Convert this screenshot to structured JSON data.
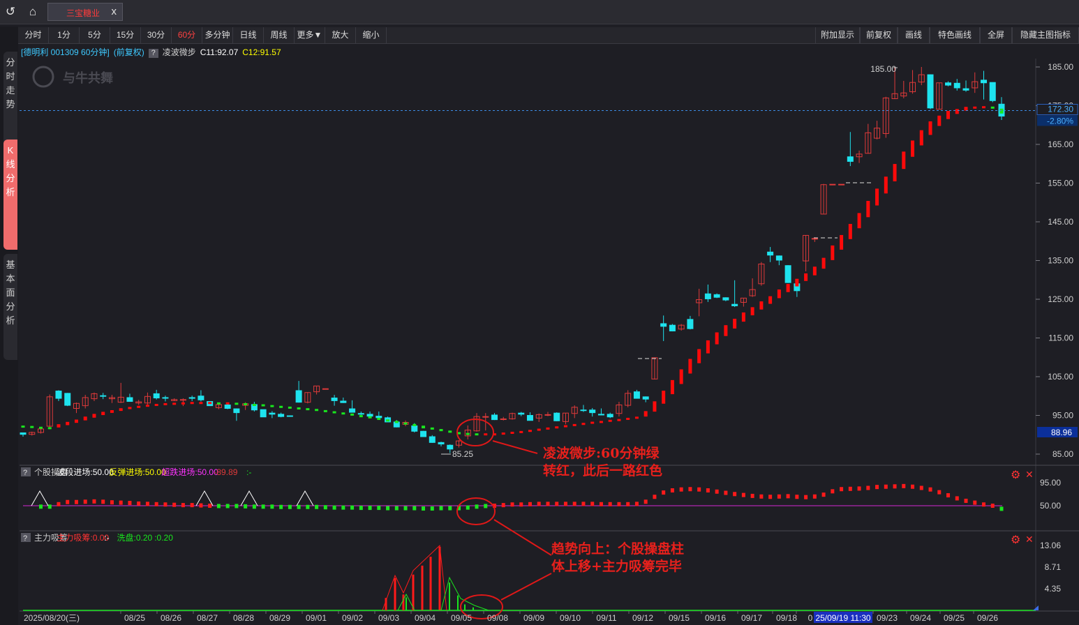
{
  "topbar": {
    "back_icon": "undo-arrow-icon",
    "home_icon": "home-icon",
    "doc_tab": "三宝糖业",
    "close": "x"
  },
  "sidebar": {
    "tabs": [
      {
        "label": "分时走势"
      },
      {
        "label": "K线分析"
      },
      {
        "label": "基本面分析"
      }
    ]
  },
  "toolbar": {
    "left": [
      "分时",
      "1分",
      "5分",
      "15分",
      "30分",
      "60分",
      "多分钟",
      "日线",
      "周线",
      "更多▼",
      "放大",
      "缩小"
    ],
    "right": [
      "附加显示",
      "前复权",
      "画线",
      "特色画线",
      "全屏",
      "隐藏主图指标"
    ],
    "active": "60分"
  },
  "info": {
    "stock": "[德明利 001309 60分钟]",
    "adj": "(前复权)",
    "help": "?",
    "indicator": "凌波微步",
    "c11": "C11:92.07",
    "c12": "C12:91.57"
  },
  "watermark": "与牛共舞",
  "main_chart": {
    "y_ticks": [
      "185.00",
      "175.00",
      "165.00",
      "155.00",
      "145.00",
      "135.00",
      "125.00",
      "115.00",
      "105.00",
      "95.00",
      "85.00"
    ],
    "last_price": "172.30",
    "last_pct": "-2.80%",
    "cursor_price": "88.96",
    "high_label": "185.00",
    "low_label": "85.25",
    "colors": {
      "up": "#e03a3a",
      "down": "#1ee3ee",
      "line_red": "#ff0a0a",
      "line_green": "#19e61e"
    }
  },
  "panel2": {
    "help": "?",
    "title": "个股操盘",
    "a": "波段进场:50.00",
    "b": "反弹进场:50.00",
    "c": "超跌进场:50.00",
    "d": "-89.89",
    "e": ":-",
    "y_ticks": [
      "95.00",
      "50.00"
    ]
  },
  "panel3": {
    "help": "?",
    "title": "主力吸筹",
    "a": "主力吸筹:0.00",
    "b": ":-",
    "c": "洗盘:0.20",
    "d": ":0.20",
    "y_ticks": [
      "13.06",
      "8.71",
      "4.35"
    ]
  },
  "gear_icon": "gear-icon",
  "close_icon": "close-icon",
  "annotations": [
    "凌波微步:60分钟绿",
    "转红，此后一路红色",
    "趋势向上：个股操盘柱",
    "体上移+主力吸筹完毕"
  ],
  "x_axis": {
    "labels": [
      "2025/08/20(三)",
      "08/25",
      "08/26",
      "08/27",
      "08/28",
      "08/29",
      "09/01",
      "09/02",
      "09/03",
      "09/04",
      "09/05",
      "09/08",
      "09/09",
      "09/10",
      "09/11",
      "09/12",
      "09/15",
      "09/16",
      "09/17",
      "09/18",
      "0",
      "25/09/19 11:30",
      "09/23",
      "09/24",
      "09/25",
      "09/26"
    ]
  },
  "chart_data": {
    "type": "candlestick",
    "title": "德明利 001309 60分钟 (前复权)",
    "interval": "60分",
    "y_range": [
      83,
      188
    ],
    "series": [
      {
        "name": "K线",
        "ohlc": [
          [
            90.5,
            90.5,
            89.5,
            90.1
          ],
          [
            90.1,
            90.8,
            89.8,
            90.6
          ],
          [
            90.6,
            91.8,
            90.3,
            91.5
          ],
          [
            92.2,
            100.4,
            91.7,
            99.8
          ],
          [
            101.3,
            101.5,
            98.7,
            99.4
          ],
          [
            100.7,
            100.8,
            97.4,
            97.6
          ],
          [
            96.8,
            98.3,
            95.6,
            98.1
          ],
          [
            97.5,
            100.3,
            96.8,
            99.6
          ],
          [
            99.3,
            100.9,
            98.7,
            100.6
          ],
          [
            100.1,
            100.8,
            99.2,
            100.0
          ],
          [
            99.3,
            100.3,
            98.2,
            99.6
          ],
          [
            98.4,
            103.4,
            98.2,
            99.7
          ],
          [
            99.6,
            100.6,
            98.6,
            98.6
          ],
          [
            98.2,
            99.0,
            97.7,
            98.5
          ],
          [
            98.2,
            100.9,
            97.8,
            99.9
          ],
          [
            100.6,
            101.6,
            99.1,
            99.5
          ],
          [
            99.6,
            100.1,
            98.6,
            99.5
          ],
          [
            98.8,
            99.4,
            98.7,
            99.1
          ],
          [
            98.9,
            99.4,
            97.4,
            99.1
          ],
          [
            99.6,
            100.1,
            98.7,
            99.4
          ],
          [
            100.0,
            101.5,
            98.6,
            99.0
          ],
          [
            98.6,
            98.6,
            97.5,
            97.5
          ],
          [
            97.0,
            98.3,
            96.6,
            97.8
          ],
          [
            97.7,
            98.3,
            96.6,
            96.8
          ],
          [
            96.7,
            96.8,
            93.6,
            95.7
          ],
          [
            97.6,
            98.4,
            96.4,
            98.0
          ],
          [
            97.8,
            98.5,
            96.0,
            96.4
          ],
          [
            96.5,
            96.5,
            94.6,
            94.6
          ],
          [
            95.6,
            96.1,
            94.3,
            95.3
          ],
          [
            95.3,
            95.7,
            94.5,
            94.7
          ],
          [
            94.9,
            95.0,
            94.7,
            94.8
          ],
          [
            101.4,
            103.9,
            98.3,
            98.4
          ],
          [
            98.4,
            101.0,
            98.1,
            100.9
          ],
          [
            101.1,
            102.5,
            100.4,
            102.6
          ],
          [
            101.9,
            101.9,
            101.7,
            101.9
          ],
          [
            99.5,
            100.3,
            97.5,
            98.8
          ],
          [
            98.7,
            99.6,
            98.2,
            98.3
          ],
          [
            96.7,
            98.9,
            95.8,
            95.8
          ],
          [
            95.5,
            96.0,
            95.1,
            95.3
          ],
          [
            95.3,
            96.0,
            94.7,
            94.8
          ],
          [
            94.8,
            96.0,
            93.9,
            94.4
          ],
          [
            94.4,
            94.7,
            93.3,
            93.3
          ],
          [
            93.3,
            93.8,
            91.9,
            92.0
          ],
          [
            92.7,
            93.7,
            92.2,
            93.2
          ],
          [
            92.3,
            93.0,
            90.6,
            90.9
          ],
          [
            90.9,
            91.0,
            89.5,
            89.5
          ],
          [
            89.5,
            89.9,
            87.9,
            88.0
          ],
          [
            88.0,
            88.2,
            87.0,
            87.6
          ],
          [
            87.3,
            87.5,
            85.3,
            86.3
          ],
          [
            87.3,
            88.6,
            86.7,
            88.4
          ],
          [
            89.7,
            92.4,
            88.8,
            91.2
          ],
          [
            91.0,
            95.6,
            90.8,
            94.7
          ],
          [
            94.7,
            95.6,
            91.1,
            94.7
          ],
          [
            95.1,
            95.6,
            93.8,
            93.9
          ],
          [
            94.0,
            94.6,
            93.7,
            94.1
          ],
          [
            94.1,
            95.7,
            93.9,
            95.5
          ],
          [
            95.6,
            95.9,
            94.8,
            95.3
          ],
          [
            95.0,
            95.8,
            93.7,
            93.7
          ],
          [
            94.3,
            95.5,
            93.3,
            95.2
          ],
          [
            95.1,
            95.9,
            94.8,
            95.2
          ],
          [
            95.6,
            95.8,
            93.5,
            93.6
          ],
          [
            93.4,
            95.6,
            92.7,
            95.6
          ],
          [
            95.5,
            97.6,
            94.3,
            97.1
          ],
          [
            96.4,
            97.7,
            95.9,
            96.3
          ],
          [
            96.4,
            96.9,
            94.7,
            95.7
          ],
          [
            95.3,
            96.8,
            95.0,
            95.1
          ],
          [
            95.3,
            95.7,
            94.3,
            94.6
          ],
          [
            95.5,
            98.5,
            94.7,
            97.7
          ],
          [
            97.6,
            101.5,
            97.1,
            100.7
          ],
          [
            101.1,
            101.6,
            99.4,
            99.4
          ],
          [
            99.8,
            99.9,
            98.4,
            99.2
          ],
          [
            104.4,
            110.0,
            104.3,
            109.9
          ],
          [
            118.7,
            120.8,
            114.2,
            118.0
          ],
          [
            118.3,
            118.6,
            116.7,
            116.8
          ],
          [
            117.3,
            118.6,
            116.9,
            118.3
          ],
          [
            119.8,
            120.7,
            117.2,
            117.4
          ],
          [
            124.1,
            127.7,
            120.6,
            124.9
          ],
          [
            126.4,
            128.8,
            124.3,
            125.1
          ],
          [
            126.2,
            126.5,
            125.3,
            125.5
          ],
          [
            125.4,
            125.5,
            124.5,
            124.8
          ],
          [
            123.7,
            129.9,
            123.0,
            123.3
          ],
          [
            124.2,
            125.2,
            123.1,
            125.3
          ],
          [
            125.9,
            130.4,
            125.6,
            127.5
          ],
          [
            129.0,
            134.6,
            128.5,
            134.1
          ],
          [
            137.2,
            138.5,
            134.6,
            136.4
          ],
          [
            136.2,
            136.3,
            133.8,
            135.1
          ],
          [
            133.7,
            133.8,
            129.2,
            129.3
          ],
          [
            129.0,
            129.1,
            125.6,
            127.2
          ],
          [
            134.9,
            141.5,
            132.2,
            141.5
          ],
          [
            140.7,
            141.0,
            139.8,
            140.7
          ],
          [
            147.0,
            154.8,
            147.1,
            154.6
          ],
          [
            154.7,
            154.7,
            154.7,
            154.7
          ],
          [
            154.7,
            154.7,
            154.6,
            154.7
          ],
          [
            161.8,
            168.2,
            159.4,
            160.6
          ],
          [
            161.8,
            163.4,
            160.2,
            162.5
          ],
          [
            162.7,
            170.3,
            162.6,
            168.0
          ],
          [
            166.6,
            171.1,
            166.3,
            169.2
          ],
          [
            167.8,
            177.3,
            166.7,
            177.0
          ],
          [
            176.8,
            185.0,
            176.7,
            178.1
          ],
          [
            177.5,
            181.4,
            176.9,
            178.3
          ],
          [
            178.6,
            184.2,
            178.1,
            181.0
          ],
          [
            181.1,
            185.0,
            180.3,
            183.0
          ],
          [
            183.0,
            183.1,
            174.1,
            174.4
          ],
          [
            174.1,
            180.9,
            174.1,
            180.9
          ],
          [
            180.9,
            181.3,
            180.0,
            180.3
          ],
          [
            180.8,
            181.9,
            178.9,
            179.6
          ],
          [
            179.4,
            181.5,
            178.6,
            179.0
          ],
          [
            179.6,
            183.6,
            178.3,
            181.2
          ],
          [
            181.6,
            184.0,
            176.6,
            180.9
          ],
          [
            181.0,
            180.5,
            175.9,
            176.3
          ],
          [
            175.4,
            177.2,
            171.3,
            172.3
          ]
        ]
      },
      {
        "name": "凌波微步",
        "values": [
          92.1,
          92.0,
          91.8,
          91.7,
          92.3,
          92.9,
          93.5,
          94.2,
          94.9,
          95.5,
          96.0,
          96.5,
          96.9,
          97.2,
          97.5,
          97.7,
          97.9,
          98.0,
          98.1,
          98.2,
          98.2,
          98.2,
          98.1,
          98.1,
          98.0,
          97.9,
          97.7,
          97.6,
          97.4,
          97.2,
          97.0,
          96.8,
          96.6,
          96.4,
          96.1,
          95.8,
          95.5,
          95.2,
          94.8,
          94.5,
          94.1,
          93.7,
          93.3,
          92.9,
          92.5,
          92.0,
          91.6,
          91.2,
          90.8,
          90.4,
          90.2,
          90.1,
          90.1,
          90.1,
          90.3,
          90.5,
          90.7,
          91.0,
          91.3,
          91.6,
          91.9,
          92.2,
          92.5,
          92.8,
          93.1,
          93.3,
          93.6,
          93.8,
          94.1,
          94.4,
          95.4,
          97.3,
          99.7,
          102.3,
          105.0,
          107.7,
          110.3,
          112.7,
          114.9,
          116.9,
          118.7,
          120.4,
          121.9,
          123.4,
          124.8,
          126.4,
          127.9,
          129.3,
          130.7,
          132.3,
          134.3,
          137.0,
          139.7,
          142.5,
          145.3,
          148.3,
          151.4,
          154.5,
          157.7,
          160.9,
          163.9,
          166.7,
          169.2,
          171.1,
          172.6,
          173.5,
          174.2,
          174.5,
          174.6,
          174.5,
          173.6
        ]
      }
    ],
    "panel2": {
      "name": "个股操盘",
      "ref": 50.0
    },
    "panel3": {
      "name": "主力吸筹",
      "max": 13.06
    }
  }
}
